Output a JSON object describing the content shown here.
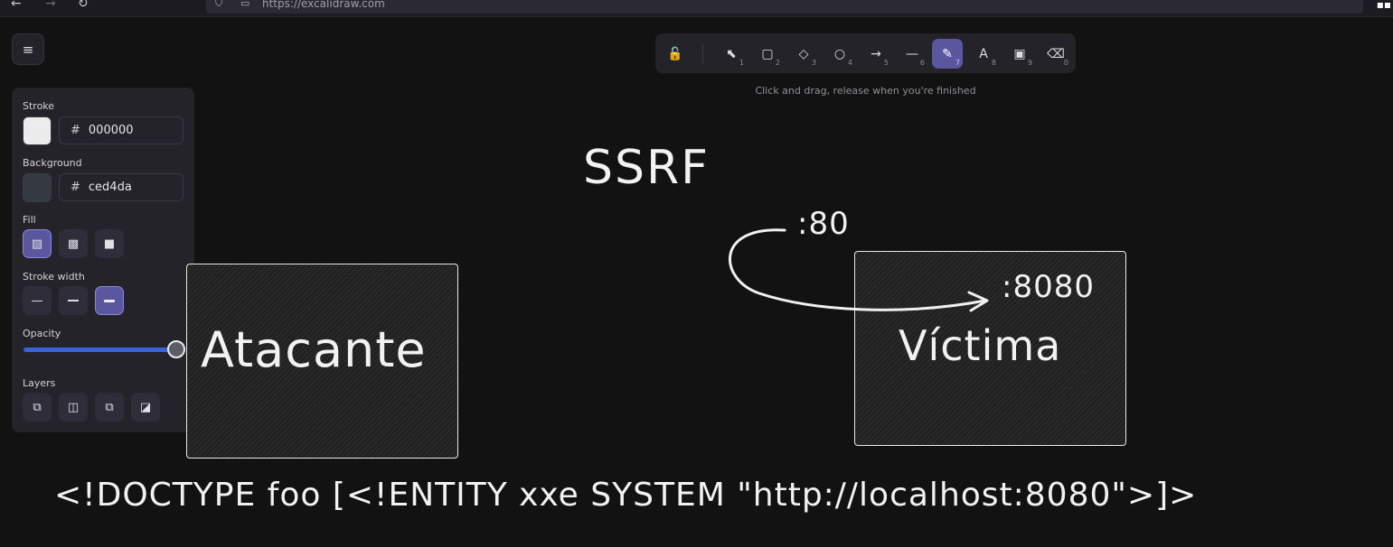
{
  "browser": {
    "url": "https://excalidraw.com",
    "back_icon": "←",
    "forward_icon": "→",
    "reload_icon": "↻"
  },
  "toolbar": {
    "tools": [
      {
        "name": "lock-icon",
        "glyph": "🔓",
        "key": ""
      },
      {
        "name": "selection-tool-icon",
        "glyph": "⬉",
        "key": "1"
      },
      {
        "name": "rectangle-tool-icon",
        "glyph": "▢",
        "key": "2"
      },
      {
        "name": "diamond-tool-icon",
        "glyph": "◇",
        "key": "3"
      },
      {
        "name": "ellipse-tool-icon",
        "glyph": "○",
        "key": "4"
      },
      {
        "name": "arrow-tool-icon",
        "glyph": "→",
        "key": "5"
      },
      {
        "name": "line-tool-icon",
        "glyph": "—",
        "key": "6"
      },
      {
        "name": "pencil-tool-icon",
        "glyph": "✎",
        "key": "7",
        "active": true
      },
      {
        "name": "text-tool-icon",
        "glyph": "A",
        "key": "8"
      },
      {
        "name": "image-tool-icon",
        "glyph": "▣",
        "key": "9"
      },
      {
        "name": "eraser-tool-icon",
        "glyph": "⌫",
        "key": "0"
      }
    ],
    "hint": "Click and drag, release when you're finished"
  },
  "panel": {
    "stroke_label": "Stroke",
    "stroke_hex": "000000",
    "stroke_color": "#ececec",
    "background_label": "Background",
    "background_hex": "ced4da",
    "background_color": "#343a40",
    "fill_label": "Fill",
    "stroke_width_label": "Stroke width",
    "opacity_label": "Opacity",
    "opacity_value": 100,
    "layers_label": "Layers",
    "hash": "#"
  },
  "canvas": {
    "title": "SSRF",
    "attacker_label": "Atacante",
    "victim_label": "Víctima",
    "port_80": ":80",
    "port_8080": ":8080",
    "payload": "<!DOCTYPE foo [<!ENTITY xxe SYSTEM \"http://localhost:8080\">]>"
  },
  "colors": {
    "accent": "#5b579e",
    "slider": "#3b62d8",
    "canvas_bg": "#121212"
  }
}
